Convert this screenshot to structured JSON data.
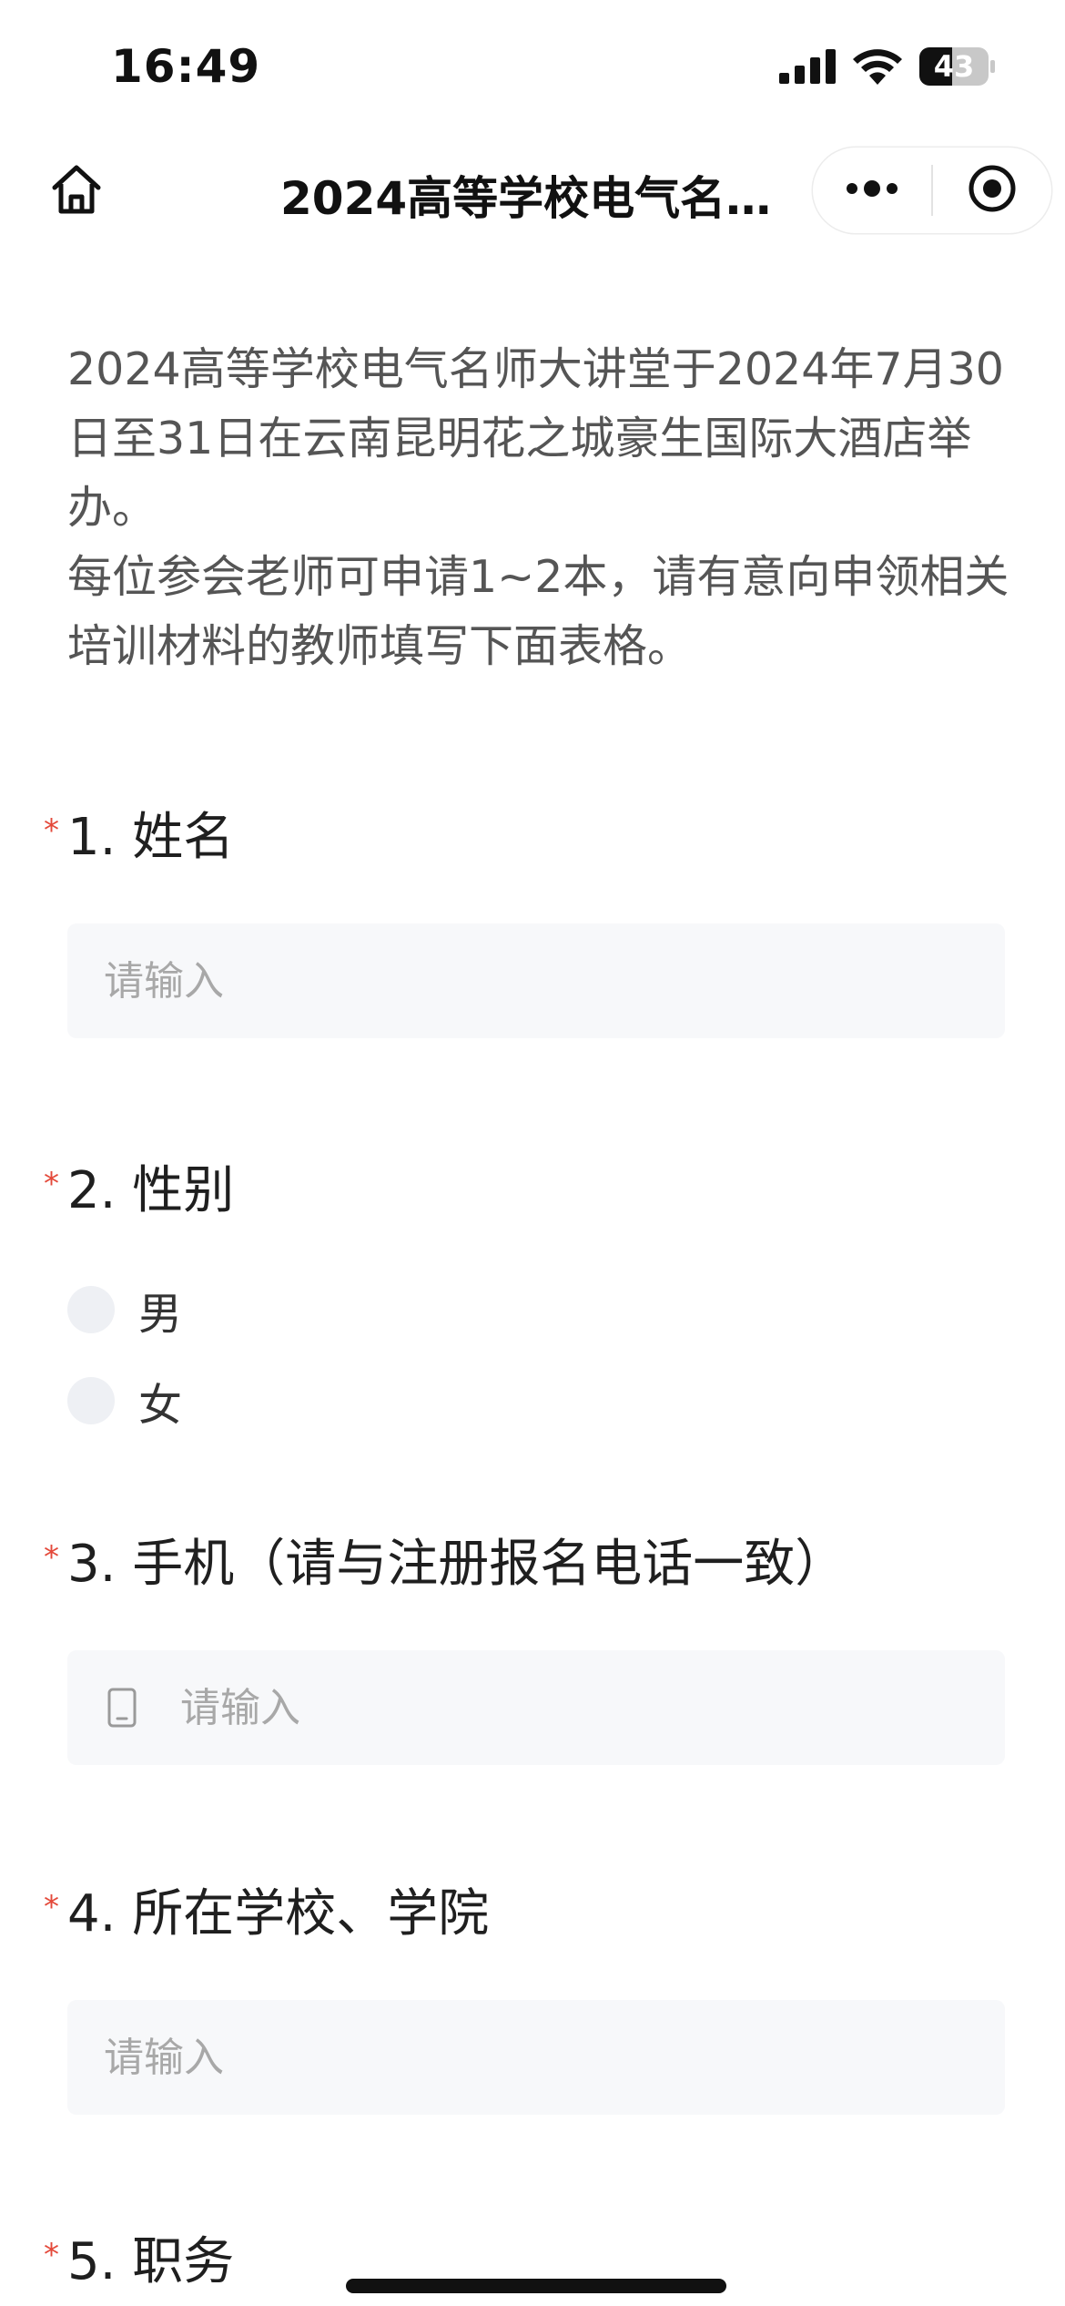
{
  "status_bar": {
    "time": "16:49",
    "battery_level": "43"
  },
  "nav": {
    "title": "2024高等学校电气名师大讲堂"
  },
  "intro": {
    "line1": "2024高等学校电气名师大讲堂于2024年7月30日至31日在云南昆明花之城豪生国际大酒店举办。",
    "line2": "每位参会老师可申请1~2本，请有意向申领相关培训材料的教师填写下面表格。"
  },
  "questions": [
    {
      "title": "1. 姓名",
      "required": "*",
      "placeholder": "请输入"
    },
    {
      "title": "2. 性别",
      "required": "*",
      "options": [
        "男",
        "女"
      ]
    },
    {
      "title": "3. 手机（请与注册报名电话一致）",
      "required": "*",
      "placeholder": "请输入"
    },
    {
      "title": "4. 所在学校、学院",
      "required": "*",
      "placeholder": "请输入"
    },
    {
      "title": "5. 职务",
      "required": "*"
    }
  ],
  "colors": {
    "required": "#e4493a",
    "input_bg": "#f7f8fa",
    "placeholder": "#a8a8a8"
  }
}
